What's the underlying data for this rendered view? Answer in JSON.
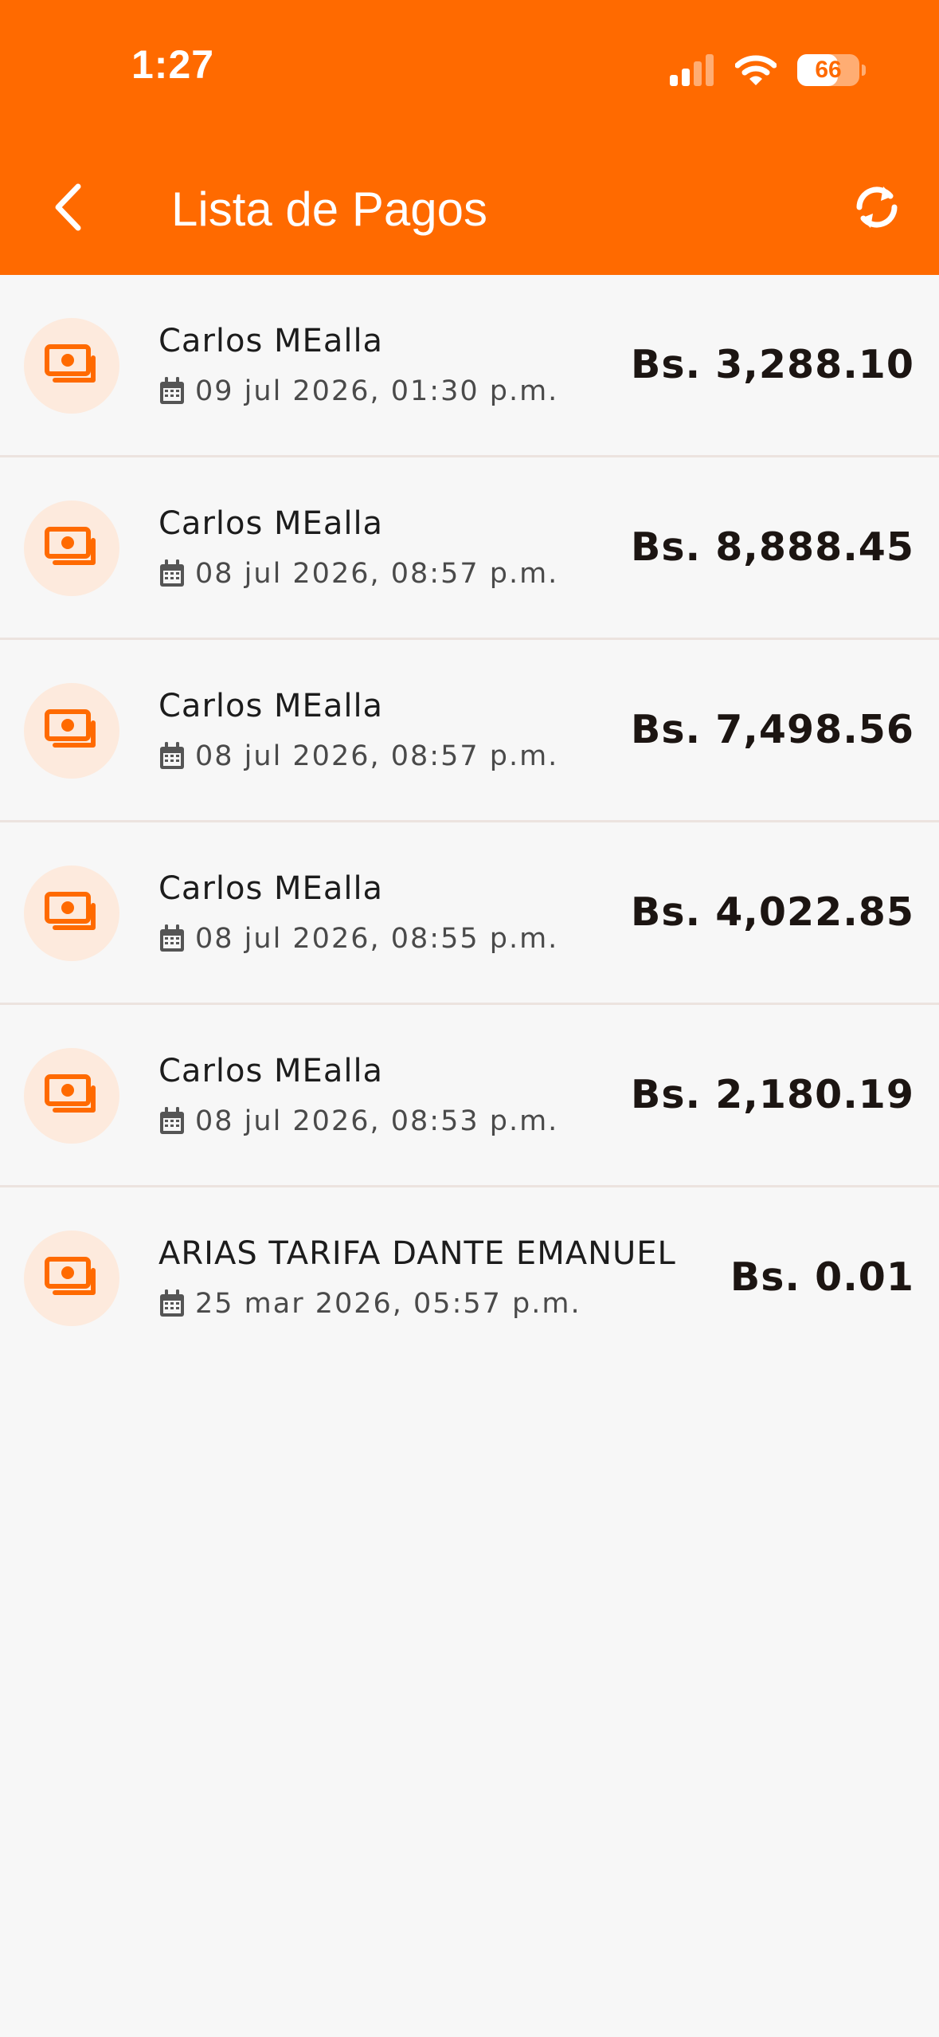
{
  "status_bar": {
    "time": "1:27",
    "battery_level": "66",
    "battery_fraction": 0.66,
    "icons": [
      "cellular-signal-icon",
      "wifi-icon",
      "battery-icon"
    ]
  },
  "header": {
    "title": "Lista de Pagos",
    "back_icon": "chevron-left-icon",
    "refresh_icon": "refresh-icon",
    "background_color": "#ff6a00"
  },
  "payments": [
    {
      "name": "Carlos MEalla",
      "date": "09 jul 2026, 01:30 p.m.",
      "amount": "Bs. 3,288.10"
    },
    {
      "name": "Carlos MEalla",
      "date": "08 jul 2026, 08:57 p.m.",
      "amount": "Bs. 8,888.45"
    },
    {
      "name": "Carlos MEalla",
      "date": "08 jul 2026, 08:57 p.m.",
      "amount": "Bs. 7,498.56"
    },
    {
      "name": "Carlos MEalla",
      "date": "08 jul 2026, 08:55 p.m.",
      "amount": "Bs. 4,022.85"
    },
    {
      "name": "Carlos MEalla",
      "date": "08 jul 2026, 08:53 p.m.",
      "amount": "Bs. 2,180.19"
    },
    {
      "name": "ARIAS TARIFA DANTE EMANUEL",
      "date": "25 mar 2026, 05:57 p.m.",
      "amount": "Bs. 0.01"
    }
  ],
  "row_icons": {
    "payment": "money-icon",
    "date": "calendar-icon"
  },
  "colors": {
    "accent": "#ff6a00",
    "icon_bg": "#fdeadd",
    "background": "#f7f7f7"
  }
}
